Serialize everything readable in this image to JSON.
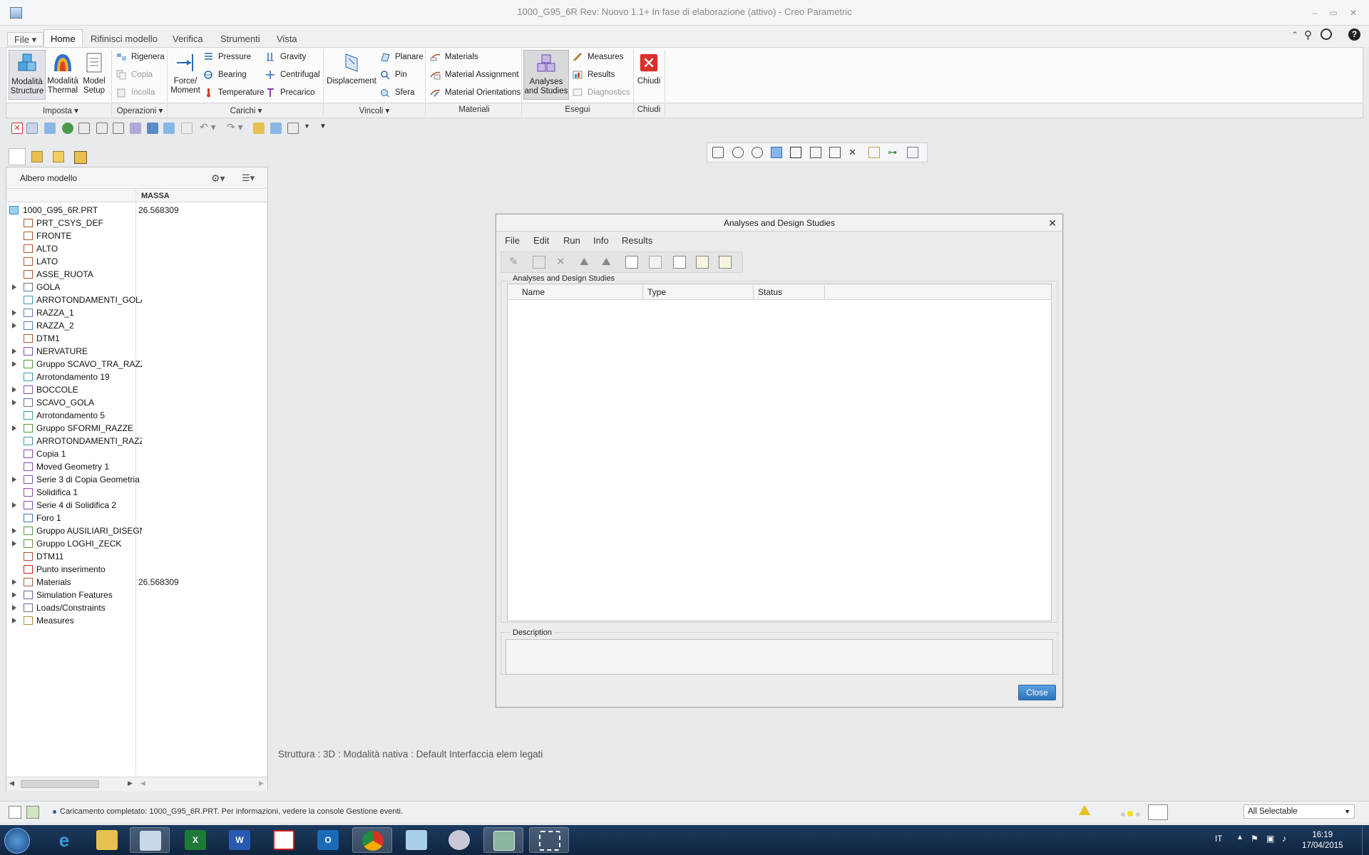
{
  "window": {
    "title": "1000_G95_6R Rev: Nuovo 1.1+ In fase di elaborazione  (attivo) - Creo Parametric"
  },
  "ribbon": {
    "tabs": [
      "File",
      "Home",
      "Rifinisci modello",
      "Verifica",
      "Strumenti",
      "Vista"
    ],
    "active_tab": "Home",
    "groups": {
      "imposta": "Imposta",
      "operazioni": "Operazioni",
      "carichi": "Carichi",
      "vincoli": "Vincoli",
      "materiali": "Materiali",
      "esegui": "Esegui",
      "chiudi": "Chiudi"
    },
    "buttons": {
      "modalita_structure": [
        "Modalità",
        "Structure"
      ],
      "modalita_thermal": [
        "Modalità",
        "Thermal"
      ],
      "model_setup": [
        "Model",
        "Setup"
      ],
      "rigenera": "Rigenera",
      "copia": "Copia",
      "incolla": "Incolla",
      "force_moment": [
        "Force/",
        "Moment"
      ],
      "pressure": "Pressure",
      "bearing": "Bearing",
      "temperature": "Temperature",
      "gravity": "Gravity",
      "centrifugal": "Centrifugal",
      "precarico": "Precarico",
      "displacement": "Displacement",
      "planare": "Planare",
      "pin": "Pin",
      "sfera": "Sfera",
      "materials": "Materials",
      "material_assignment": "Material Assignment",
      "material_orientations": "Material Orientations",
      "analyses_and_studies": [
        "Analyses",
        "and Studies"
      ],
      "measures": "Measures",
      "results": "Results",
      "diagnostics": "Diagnostics",
      "chiudi": "Chiudi"
    }
  },
  "model_tree": {
    "title": "Albero modello",
    "column": "MASSA",
    "items": [
      {
        "label": "1000_G95_6R.PRT",
        "value": "26.568309",
        "expand": false,
        "icon": "part-icon",
        "color": "#3a8fd0"
      },
      {
        "label": "PRT_CSYS_DEF",
        "value": "",
        "expand": false,
        "icon": "csys-icon",
        "color": "#b0552c"
      },
      {
        "label": "FRONTE",
        "value": "",
        "expand": false,
        "icon": "plane-icon",
        "color": "#b0552c"
      },
      {
        "label": "ALTO",
        "value": "",
        "expand": false,
        "icon": "plane-icon",
        "color": "#b0552c"
      },
      {
        "label": "LATO",
        "value": "",
        "expand": false,
        "icon": "plane-icon",
        "color": "#b0552c"
      },
      {
        "label": "ASSE_RUOTA",
        "value": "",
        "expand": false,
        "icon": "axis-icon",
        "color": "#b0552c"
      },
      {
        "label": "GOLA",
        "value": "",
        "expand": true,
        "icon": "revolve-icon",
        "color": "#6a6a9a"
      },
      {
        "label": "ARROTONDAMENTI_GOLA",
        "value": "",
        "expand": false,
        "icon": "round-icon",
        "color": "#3a9ab0"
      },
      {
        "label": "RAZZA_1",
        "value": "",
        "expand": true,
        "icon": "extrude-icon",
        "color": "#5a7ab0"
      },
      {
        "label": "RAZZA_2",
        "value": "",
        "expand": true,
        "icon": "extrude-icon",
        "color": "#5a7ab0"
      },
      {
        "label": "DTM1",
        "value": "",
        "expand": false,
        "icon": "plane-icon",
        "color": "#b0552c"
      },
      {
        "label": "NERVATURE",
        "value": "",
        "expand": true,
        "icon": "pattern-icon",
        "color": "#8a4ab0"
      },
      {
        "label": "Gruppo SCAVO_TRA_RAZZE",
        "value": "",
        "expand": true,
        "icon": "group-icon",
        "color": "#5a9a3a"
      },
      {
        "label": "Arrotondamento 19",
        "value": "",
        "expand": false,
        "icon": "round-icon",
        "color": "#3a9ab0"
      },
      {
        "label": "BOCCOLE",
        "value": "",
        "expand": true,
        "icon": "pattern-icon",
        "color": "#8a4ab0"
      },
      {
        "label": "SCAVO_GOLA",
        "value": "",
        "expand": true,
        "icon": "revolve-icon",
        "color": "#6a6a9a"
      },
      {
        "label": "Arrotondamento 5",
        "value": "",
        "expand": false,
        "icon": "round-icon",
        "color": "#3a9ab0"
      },
      {
        "label": "Gruppo SFORMI_RAZZE",
        "value": "",
        "expand": true,
        "icon": "group-icon",
        "color": "#5a9a3a"
      },
      {
        "label": "ARROTONDAMENTI_RAZZE",
        "value": "",
        "expand": false,
        "icon": "round-icon",
        "color": "#3a9ab0"
      },
      {
        "label": "Copia 1",
        "value": "",
        "expand": false,
        "icon": "copy-geom-icon",
        "color": "#8a4ab0"
      },
      {
        "label": "Moved Geometry 1",
        "value": "",
        "expand": false,
        "icon": "move-geom-icon",
        "color": "#8a4ab0"
      },
      {
        "label": "Serie 3 di Copia Geometria",
        "value": "",
        "expand": true,
        "icon": "pattern-icon",
        "color": "#8a4ab0"
      },
      {
        "label": "Solidifica 1",
        "value": "",
        "expand": false,
        "icon": "solidify-icon",
        "color": "#8a4ab0"
      },
      {
        "label": "Serie 4 di Solidifica 2",
        "value": "",
        "expand": true,
        "icon": "pattern-icon",
        "color": "#8a4ab0"
      },
      {
        "label": "Foro 1",
        "value": "",
        "expand": false,
        "icon": "hole-icon",
        "color": "#3a7ab0"
      },
      {
        "label": "Gruppo AUSILIARI_DISEGNO",
        "value": "",
        "expand": true,
        "icon": "group-icon",
        "color": "#5a9a3a"
      },
      {
        "label": "Gruppo LOGHI_ZECK",
        "value": "",
        "expand": true,
        "icon": "group-icon",
        "color": "#5a9a3a"
      },
      {
        "label": "DTM11",
        "value": "",
        "expand": false,
        "icon": "plane-icon",
        "color": "#b0552c"
      },
      {
        "label": "Punto inserimento",
        "value": "",
        "expand": false,
        "icon": "insert-arrow-icon",
        "color": "#d02020"
      },
      {
        "label": "Materials",
        "value": "26.568309",
        "expand": true,
        "icon": "materials-icon",
        "color": "#b0552c"
      },
      {
        "label": "Simulation Features",
        "value": "",
        "expand": true,
        "icon": "simulation-icon",
        "color": "#6a6a9a"
      },
      {
        "label": "Loads/Constraints",
        "value": "",
        "expand": true,
        "icon": "loads-icon",
        "color": "#6a6a9a"
      },
      {
        "label": "Measures",
        "value": "",
        "expand": true,
        "icon": "measure-icon",
        "color": "#b08a3a"
      }
    ]
  },
  "graphics": {
    "status_text": "Struttura : 3D : Modalità nativa : Default Interfaccia elem legati"
  },
  "dialog": {
    "title": "Analyses and Design Studies",
    "menu": [
      "File",
      "Edit",
      "Run",
      "Info",
      "Results"
    ],
    "group_label": "Analyses and Design Studies",
    "columns": [
      "Name",
      "Type",
      "Status"
    ],
    "description_label": "Description",
    "close_label": "Close"
  },
  "statusbar": {
    "message": "Caricamento completato: 1000_G95_6R.PRT. Per informazioni, vedere la console Gestione eventi.",
    "filter": "All Selectable"
  },
  "taskbar": {
    "language": "IT",
    "time": "16:19",
    "date": "17/04/2015"
  },
  "colors": {
    "accent": "#2e73b8",
    "close_button": "#d9302c",
    "taskbar": "#0f2540"
  }
}
